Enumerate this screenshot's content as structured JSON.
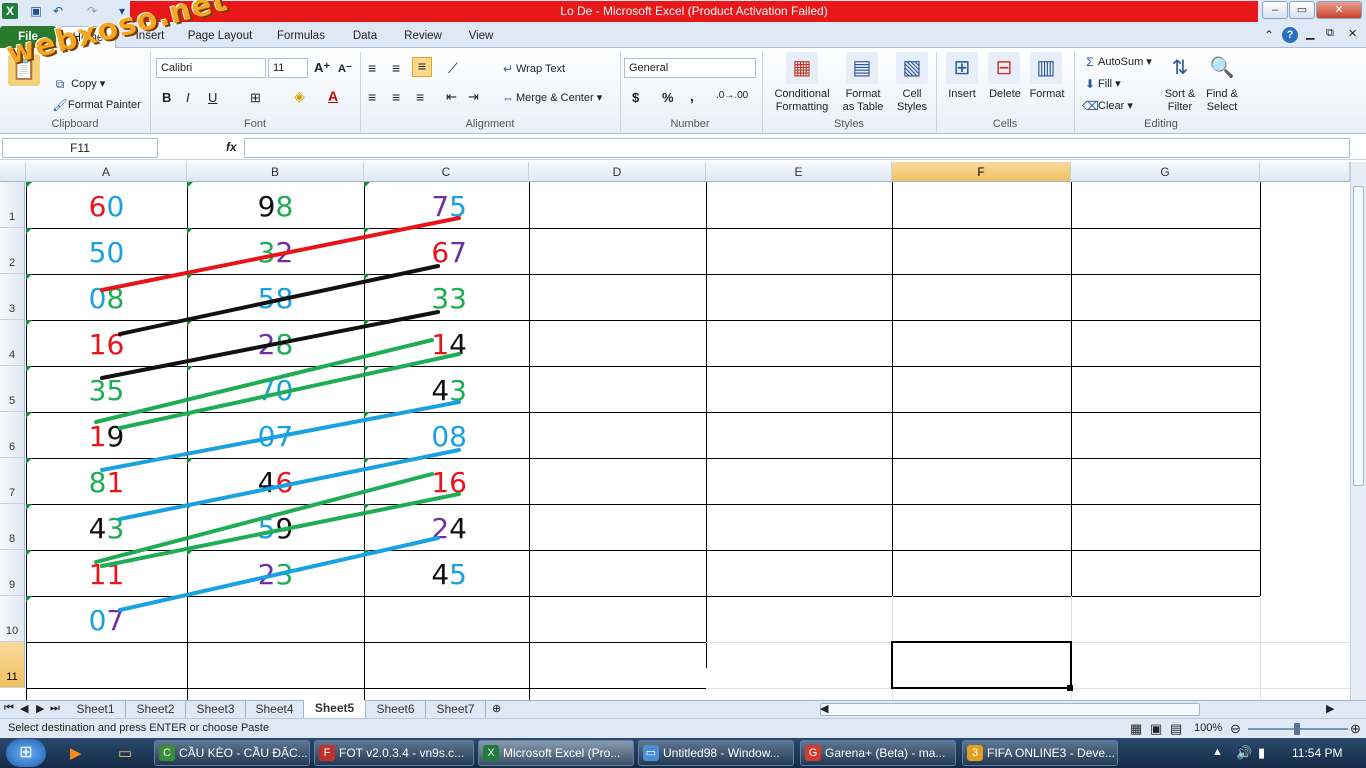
{
  "window": {
    "title": "Lo De  -  Microsoft Excel (Product Activation Failed)",
    "minimize": "–",
    "restore": "▭",
    "close": "✕"
  },
  "watermark": "webxoso.net",
  "tabs": [
    {
      "label": "File"
    },
    {
      "label": "Home"
    },
    {
      "label": "Insert"
    },
    {
      "label": "Page Layout"
    },
    {
      "label": "Formulas"
    },
    {
      "label": "Data"
    },
    {
      "label": "Review"
    },
    {
      "label": "View"
    }
  ],
  "ribbon": {
    "clipboard": {
      "copy": "Copy",
      "format_painter": "Format Painter",
      "group": "Clipboard"
    },
    "font": {
      "name": "Calibri",
      "size": "11",
      "bold": "B",
      "italic": "I",
      "underline": "U",
      "group": "Font"
    },
    "alignment": {
      "wrap": "Wrap Text",
      "merge": "Merge & Center",
      "group": "Alignment"
    },
    "number": {
      "format": "General",
      "currency": "$",
      "percent": "%",
      "comma": ",",
      "group": "Number"
    },
    "styles": {
      "conditional": "Conditional",
      "conditional2": "Formatting",
      "format_table": "Format",
      "format_table2": "as Table",
      "cell_styles": "Cell",
      "cell_styles2": "Styles",
      "group": "Styles"
    },
    "cells": {
      "insert": "Insert",
      "delete": "Delete",
      "format": "Format",
      "group": "Cells"
    },
    "editing": {
      "autosum": "AutoSum",
      "fill": "Fill",
      "clear": "Clear",
      "sort": "Sort &",
      "sort2": "Filter",
      "find": "Find &",
      "find2": "Select",
      "group": "Editing"
    }
  },
  "formula_bar": {
    "name_box": "F11",
    "fx": "fx",
    "value": ""
  },
  "columns": [
    "A",
    "B",
    "C",
    "D",
    "E",
    "F",
    "G"
  ],
  "rows": [
    "1",
    "2",
    "3",
    "4",
    "5",
    "6",
    "7",
    "8",
    "9",
    "10",
    "11"
  ],
  "cells": {
    "A1": [
      "6",
      "0"
    ],
    "B1": [
      "9",
      "8"
    ],
    "C1": [
      "7",
      "5"
    ],
    "A2": [
      "5",
      "0"
    ],
    "B2": [
      "3",
      "2"
    ],
    "C2": [
      "6",
      "7"
    ],
    "A3": [
      "0",
      "8"
    ],
    "B3": [
      "5",
      "8"
    ],
    "C3": [
      "3",
      "3"
    ],
    "A4": [
      "1",
      "6"
    ],
    "B4": [
      "2",
      "8"
    ],
    "C4": [
      "1",
      "4"
    ],
    "A5": [
      "3",
      "5"
    ],
    "B5": [
      "7",
      "0"
    ],
    "C5": [
      "4",
      "3"
    ],
    "A6": [
      "1",
      "9"
    ],
    "B6": [
      "0",
      "7"
    ],
    "C6": [
      "0",
      "8"
    ],
    "A7": [
      "8",
      "1"
    ],
    "B7": [
      "4",
      "6"
    ],
    "C7": [
      "1",
      "6"
    ],
    "A8": [
      "4",
      "3"
    ],
    "B8": [
      "5",
      "9"
    ],
    "C8": [
      "2",
      "4"
    ],
    "A9": [
      "1",
      "1"
    ],
    "B9": [
      "2",
      "3"
    ],
    "C9": [
      "4",
      "5"
    ],
    "A10": [
      "0",
      "7"
    ]
  },
  "colors": {
    "red": "#e8141c",
    "blue": "#1aa1e0",
    "green": "#1ead55",
    "purple": "#7030a0",
    "black": "#111111",
    "title_red": "#e81818",
    "file_green": "#2a7a2e"
  },
  "sheets": [
    "Sheet1",
    "Sheet2",
    "Sheet3",
    "Sheet4",
    "Sheet5",
    "Sheet6",
    "Sheet7"
  ],
  "active_sheet": "Sheet5",
  "status": {
    "message": "Select destination and press ENTER or choose Paste",
    "zoom": "100%"
  },
  "taskbar": {
    "items": [
      {
        "label": "CẦU KÈO - CẦU ĐẶC..."
      },
      {
        "label": "FOT v2.0.3.4 - vn9s.c..."
      },
      {
        "label": "Microsoft Excel (Pro..."
      },
      {
        "label": "Untitled98 - Window..."
      },
      {
        "label": "Garena+ (Beta) - ma..."
      },
      {
        "label": "FIFA ONLINE3 - Deve..."
      }
    ],
    "clock": "11:54 PM"
  }
}
